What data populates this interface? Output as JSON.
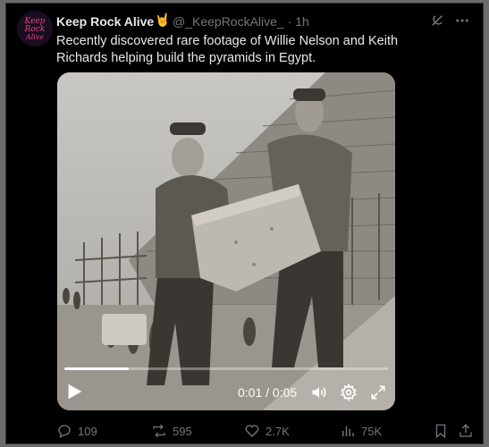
{
  "post": {
    "display_name": "Keep Rock Alive",
    "badge_emoji": "🤘",
    "handle": "@_KeepRockAlive_",
    "separator": "·",
    "time_ago": "1h",
    "text": "Recently discovered rare footage of Willie Nelson and Keith Richards helping build the pyramids in Egypt.",
    "avatar_text": [
      "Keep",
      "Rock",
      "Alive"
    ]
  },
  "video": {
    "current_time": "0:01",
    "duration": "0:05",
    "time_display": "0:01 / 0:05",
    "progress": 0.2
  },
  "actions": {
    "replies": "109",
    "reposts": "595",
    "likes": "2.7K",
    "views": "75K"
  },
  "colors": {
    "background": "#000000",
    "text": "#e7e9ea",
    "muted": "#71767b",
    "border": "#2f3336",
    "avatar_accent": "#e6457a"
  },
  "icons": [
    "grok-icon",
    "more-icon",
    "play-icon",
    "volume-icon",
    "settings-icon",
    "fullscreen-icon",
    "reply-icon",
    "repost-icon",
    "like-icon",
    "views-icon",
    "bookmark-icon",
    "share-icon"
  ]
}
